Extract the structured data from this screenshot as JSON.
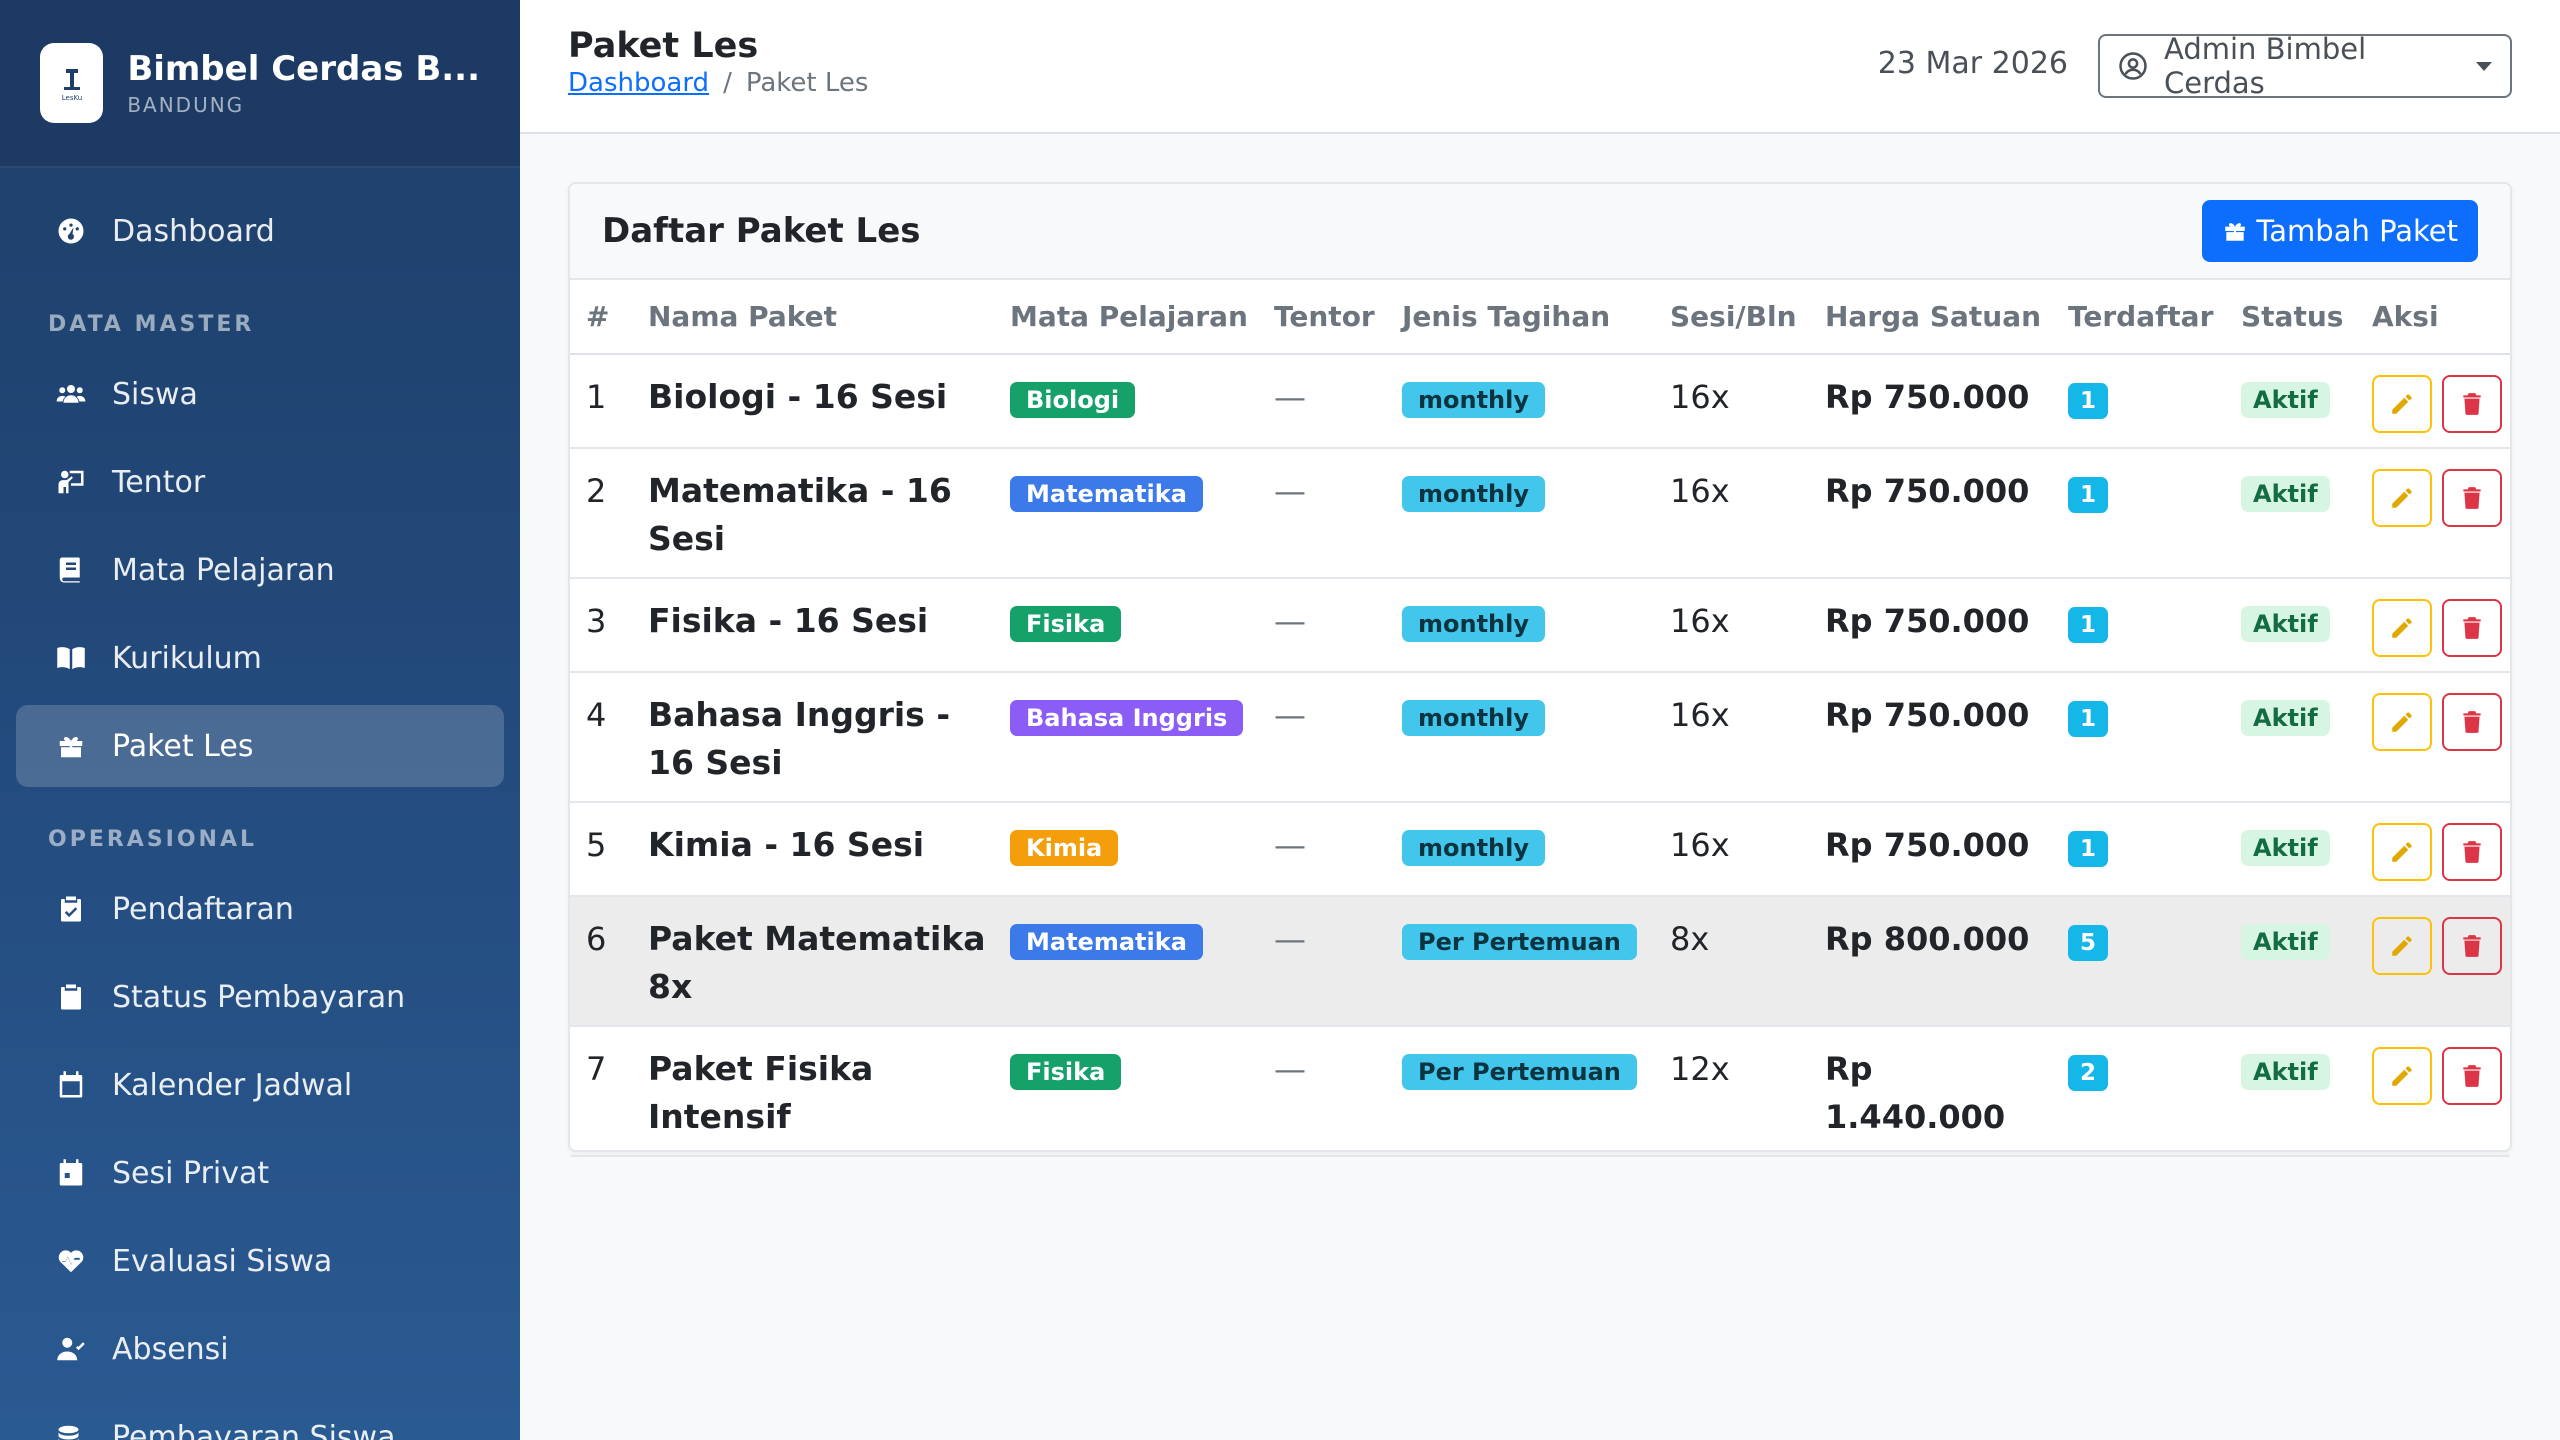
{
  "brand": {
    "name": "Bimbel Cerdas B...",
    "city": "BANDUNG",
    "logo_text": "LesKu"
  },
  "sidebar": {
    "items_top": [
      {
        "label": "Dashboard",
        "icon": "gauge-icon"
      }
    ],
    "section1": "DATA MASTER",
    "items_master": [
      {
        "label": "Siswa",
        "icon": "users-icon"
      },
      {
        "label": "Tentor",
        "icon": "teacher-icon"
      },
      {
        "label": "Mata Pelajaran",
        "icon": "book-icon"
      },
      {
        "label": "Kurikulum",
        "icon": "open-book-icon"
      },
      {
        "label": "Paket Les",
        "icon": "gift-icon"
      }
    ],
    "section2": "OPERASIONAL",
    "items_ops": [
      {
        "label": "Pendaftaran",
        "icon": "clipboard-check-icon"
      },
      {
        "label": "Status Pembayaran",
        "icon": "clipboard-icon"
      },
      {
        "label": "Kalender Jadwal",
        "icon": "calendar-icon"
      },
      {
        "label": "Sesi Privat",
        "icon": "calendar-day-icon"
      },
      {
        "label": "Evaluasi Siswa",
        "icon": "heart-pulse-icon"
      },
      {
        "label": "Absensi",
        "icon": "user-check-icon"
      },
      {
        "label": "Pembayaran Siswa",
        "icon": "coins-icon"
      }
    ]
  },
  "topbar": {
    "title": "Paket Les",
    "breadcrumb_home": "Dashboard",
    "breadcrumb_sep": "/",
    "breadcrumb_current": "Paket Les",
    "date": "23 Mar 2026",
    "user": "Admin Bimbel Cerdas"
  },
  "card": {
    "title": "Daftar Paket Les",
    "add_button": "Tambah Paket",
    "columns": [
      "#",
      "Nama Paket",
      "Mata Pelajaran",
      "Tentor",
      "Jenis Tagihan",
      "Sesi/Bln",
      "Harga Satuan",
      "Terdaftar",
      "Status",
      "Aksi"
    ],
    "rows": [
      {
        "no": "1",
        "name": "Biologi - 16 Sesi",
        "subject": "Biologi",
        "subject_color": "#16a06a",
        "tentor": "—",
        "billing": "monthly",
        "sessions": "16x",
        "price": "Rp 750.000",
        "enrolled": "1",
        "status": "Aktif"
      },
      {
        "no": "2",
        "name": "Matematika - 16 Sesi",
        "subject": "Matematika",
        "subject_color": "#3b7ae8",
        "tentor": "—",
        "billing": "monthly",
        "sessions": "16x",
        "price": "Rp 750.000",
        "enrolled": "1",
        "status": "Aktif"
      },
      {
        "no": "3",
        "name": "Fisika - 16 Sesi",
        "subject": "Fisika",
        "subject_color": "#16a06a",
        "tentor": "—",
        "billing": "monthly",
        "sessions": "16x",
        "price": "Rp 750.000",
        "enrolled": "1",
        "status": "Aktif"
      },
      {
        "no": "4",
        "name": "Bahasa Inggris - 16 Sesi",
        "subject": "Bahasa Inggris",
        "subject_color": "#8b5cf6",
        "tentor": "—",
        "billing": "monthly",
        "sessions": "16x",
        "price": "Rp 750.000",
        "enrolled": "1",
        "status": "Aktif"
      },
      {
        "no": "5",
        "name": "Kimia - 16 Sesi",
        "subject": "Kimia",
        "subject_color": "#f59e0b",
        "tentor": "—",
        "billing": "monthly",
        "sessions": "16x",
        "price": "Rp 750.000",
        "enrolled": "1",
        "status": "Aktif"
      },
      {
        "no": "6",
        "name": "Paket Matematika 8x",
        "subject": "Matematika",
        "subject_color": "#3b7ae8",
        "tentor": "—",
        "billing": "Per Pertemuan",
        "sessions": "8x",
        "price": "Rp 800.000",
        "enrolled": "5",
        "status": "Aktif"
      },
      {
        "no": "7",
        "name": "Paket Fisika Intensif",
        "subject": "Fisika",
        "subject_color": "#16a06a",
        "tentor": "—",
        "billing": "Per Pertemuan",
        "sessions": "12x",
        "price": "Rp 1.440.000",
        "enrolled": "2",
        "status": "Aktif"
      }
    ],
    "highlighted_row": "6"
  }
}
